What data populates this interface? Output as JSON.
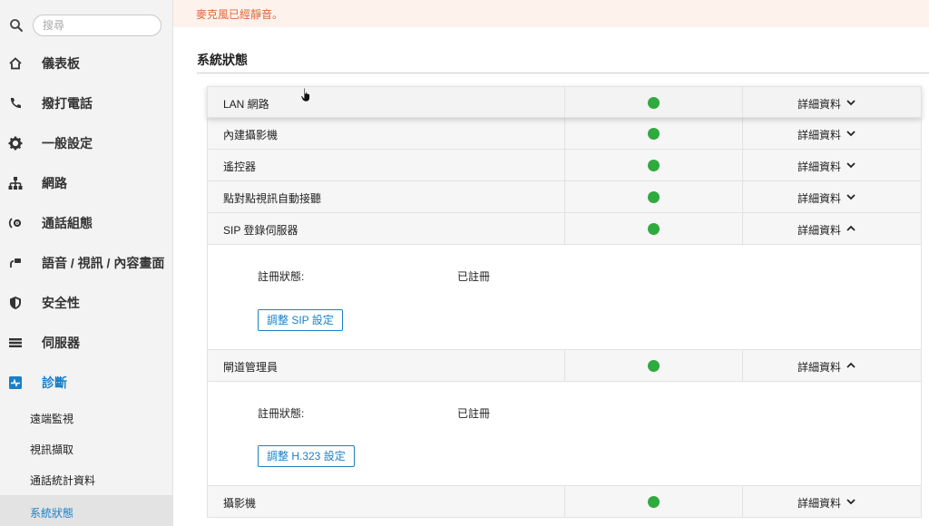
{
  "search": {
    "placeholder": "搜尋"
  },
  "nav": {
    "items": [
      {
        "label": "儀表板",
        "icon": "home-icon"
      },
      {
        "label": "撥打電話",
        "icon": "phone-icon"
      },
      {
        "label": "一般設定",
        "icon": "gear-icon"
      },
      {
        "label": "網路",
        "icon": "network-icon"
      },
      {
        "label": "通話組態",
        "icon": "call-config-icon"
      },
      {
        "label": "語音 / 視訊 / 內容畫面",
        "icon": "av-icon"
      },
      {
        "label": "安全性",
        "icon": "shield-icon"
      },
      {
        "label": "伺服器",
        "icon": "server-icon"
      },
      {
        "label": "診斷",
        "icon": "diagnostics-icon"
      }
    ],
    "sub_items": [
      {
        "label": "遠端監視"
      },
      {
        "label": "視訊擷取"
      },
      {
        "label": "通話統計資料"
      },
      {
        "label": "系統狀態"
      }
    ]
  },
  "notice": {
    "text": "麥克風已經靜音。"
  },
  "main": {
    "title": "系統狀態",
    "detail_label": "詳細資料",
    "rows": [
      {
        "name": "LAN 網路",
        "status": "ok",
        "expanded": false
      },
      {
        "name": "內建攝影機",
        "status": "ok",
        "expanded": false
      },
      {
        "name": "遙控器",
        "status": "ok",
        "expanded": false
      },
      {
        "name": "點對點視訊自動接聽",
        "status": "ok",
        "expanded": false
      },
      {
        "name": "SIP 登錄伺服器",
        "status": "ok",
        "expanded": true,
        "detail": {
          "key": "註冊狀態:",
          "value": "已註冊",
          "button": "調整 SIP 設定"
        }
      },
      {
        "name": "閘道管理員",
        "status": "ok",
        "expanded": true,
        "detail": {
          "key": "註冊狀態:",
          "value": "已註冊",
          "button": "調整 H.323 設定"
        }
      },
      {
        "name": "攝影機",
        "status": "ok",
        "expanded": false
      }
    ]
  },
  "colors": {
    "accent": "#1a7fc7",
    "status_ok": "#2eaa3e",
    "notice_text": "#e0663a",
    "notice_bg": "#fdf3ec"
  }
}
